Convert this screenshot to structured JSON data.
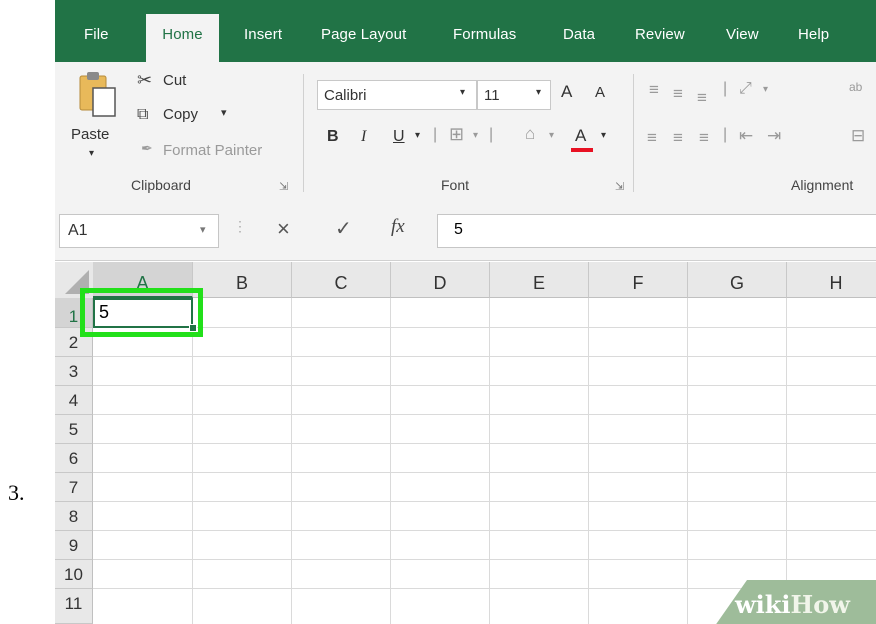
{
  "step_number": "3.",
  "tabs": [
    "File",
    "Home",
    "Insert",
    "Page Layout",
    "Formulas",
    "Data",
    "Review",
    "View",
    "Help"
  ],
  "active_tab": "Home",
  "clipboard": {
    "paste": "Paste",
    "cut": "Cut",
    "copy": "Copy",
    "format_painter": "Format Painter",
    "label": "Clipboard"
  },
  "font": {
    "name": "Calibri",
    "size": "11",
    "bold": "B",
    "italic": "I",
    "underline": "U",
    "font_color": "A",
    "grow": "A",
    "shrink": "A",
    "label": "Font"
  },
  "alignment": {
    "label": "Alignment",
    "wrap": "ab"
  },
  "formula_bar": {
    "name_box": "A1",
    "cancel": "×",
    "enter": "✓",
    "fx": "fx",
    "content": "5"
  },
  "columns": [
    "A",
    "B",
    "C",
    "D",
    "E",
    "F",
    "G",
    "H"
  ],
  "rows": [
    "1",
    "2",
    "3",
    "4",
    "5",
    "6",
    "7",
    "8",
    "9",
    "10",
    "11"
  ],
  "cell_a1": "5",
  "watermark": {
    "wiki": "wiki",
    "how": "How"
  },
  "colors": {
    "brand_green": "#217346",
    "highlight": "#22e01a",
    "font_red": "#e81123"
  }
}
